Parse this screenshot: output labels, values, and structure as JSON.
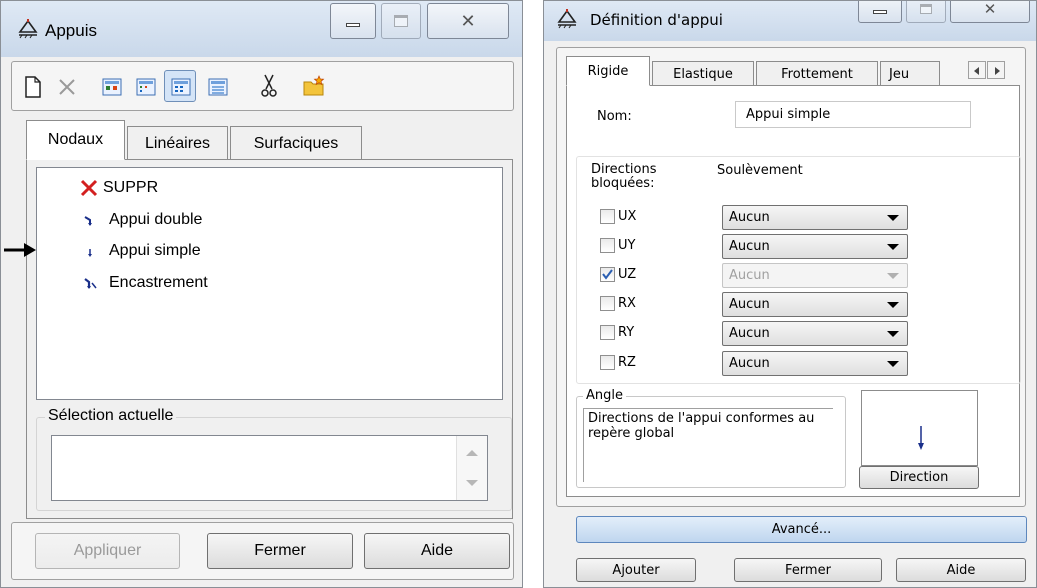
{
  "appuis_window": {
    "title": "Appuis",
    "toolbar": [
      "new-icon",
      "delete-icon",
      "view-icons-large-icon",
      "view-icons-small-icon",
      "view-list-icon",
      "view-details-icon",
      "cut-icon",
      "folder-star-icon"
    ],
    "tabs": [
      "Nodaux",
      "Linéaires",
      "Surfaciques"
    ],
    "active_tab": "Nodaux",
    "items": [
      {
        "label": "SUPPR",
        "icon": "red-x-icon",
        "arrow": false
      },
      {
        "label": "Appui double",
        "icon": "support-double-icon",
        "arrow": false
      },
      {
        "label": "Appui simple",
        "icon": "support-simple-icon",
        "arrow": true
      },
      {
        "label": "Encastrement",
        "icon": "support-fixed-icon",
        "arrow": false
      }
    ],
    "selection_group_title": "Sélection actuelle",
    "selection_value": "",
    "buttons": {
      "apply": "Appliquer",
      "close": "Fermer",
      "help": "Aide"
    }
  },
  "definition_window": {
    "title": "Définition d'appui",
    "tabs": [
      "Rigide",
      "Elastique",
      "Frottement",
      "Jeu"
    ],
    "active_tab": "Rigide",
    "name_label": "Nom:",
    "name_value": "Appui simple",
    "directions_header": "Directions bloquées:",
    "uplift_header": "Soulèvement",
    "directions": [
      {
        "label": "UX",
        "checked": false,
        "value": "Aucun",
        "enabled": true
      },
      {
        "label": "UY",
        "checked": false,
        "value": "Aucun",
        "enabled": true
      },
      {
        "label": "UZ",
        "checked": true,
        "value": "Aucun",
        "enabled": false
      },
      {
        "label": "RX",
        "checked": false,
        "value": "Aucun",
        "enabled": true
      },
      {
        "label": "RY",
        "checked": false,
        "value": "Aucun",
        "enabled": true
      },
      {
        "label": "RZ",
        "checked": false,
        "value": "Aucun",
        "enabled": true
      }
    ],
    "angle_title": "Angle",
    "angle_text": "Directions de l'appui conformes au repère global",
    "direction_button": "Direction",
    "advanced_button": "Avancé...",
    "buttons": {
      "add": "Ajouter",
      "close": "Fermer",
      "help": "Aide"
    }
  }
}
